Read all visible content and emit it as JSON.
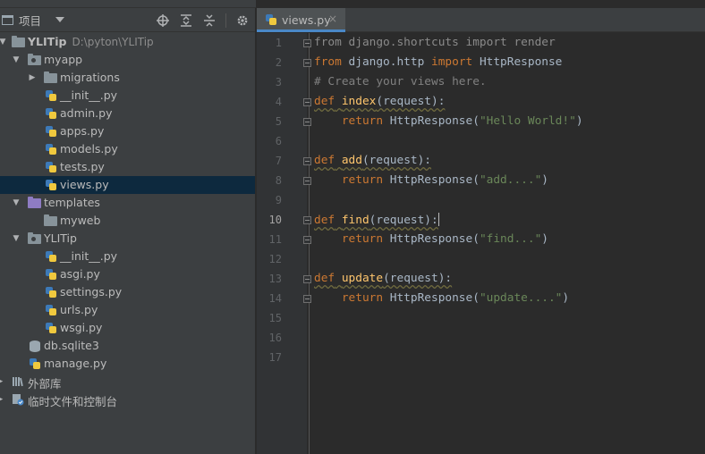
{
  "project_panel": {
    "title": "项目",
    "tree": [
      {
        "label": "YLITip",
        "path": "D:\\pyton\\YLITip",
        "level": 0,
        "kind": "folder",
        "expanded": true
      },
      {
        "label": "myapp",
        "level": 1,
        "kind": "folder-dot",
        "expanded": true
      },
      {
        "label": "migrations",
        "level": 2,
        "kind": "folder",
        "expanded": false
      },
      {
        "label": "__init__.py",
        "level": 2,
        "kind": "py"
      },
      {
        "label": "admin.py",
        "level": 2,
        "kind": "py"
      },
      {
        "label": "apps.py",
        "level": 2,
        "kind": "py"
      },
      {
        "label": "models.py",
        "level": 2,
        "kind": "py"
      },
      {
        "label": "tests.py",
        "level": 2,
        "kind": "py"
      },
      {
        "label": "views.py",
        "level": 2,
        "kind": "py",
        "selected": true
      },
      {
        "label": "templates",
        "level": 1,
        "kind": "folder-purple",
        "expanded": true
      },
      {
        "label": "myweb",
        "level": 2,
        "kind": "folder"
      },
      {
        "label": "YLITip",
        "level": 1,
        "kind": "folder-dot",
        "expanded": true
      },
      {
        "label": "__init__.py",
        "level": 2,
        "kind": "py"
      },
      {
        "label": "asgi.py",
        "level": 2,
        "kind": "py"
      },
      {
        "label": "settings.py",
        "level": 2,
        "kind": "py"
      },
      {
        "label": "urls.py",
        "level": 2,
        "kind": "py"
      },
      {
        "label": "wsgi.py",
        "level": 2,
        "kind": "py"
      },
      {
        "label": "db.sqlite3",
        "level": 1,
        "kind": "db"
      },
      {
        "label": "manage.py",
        "level": 1,
        "kind": "py"
      },
      {
        "label": "外部库",
        "level": 0,
        "kind": "lib",
        "expanded": false
      },
      {
        "label": "临时文件和控制台",
        "level": 0,
        "kind": "scratch",
        "expanded": false
      }
    ]
  },
  "editor": {
    "tab_label": "views.py",
    "tab_close": "×",
    "active_line": 10,
    "line_numbers": [
      "1",
      "2",
      "3",
      "4",
      "5",
      "6",
      "7",
      "8",
      "9",
      "10",
      "11",
      "12",
      "13",
      "14",
      "15",
      "16",
      "17"
    ],
    "code": {
      "l1_kw1": "from",
      "l1_mod": " django.shortcuts ",
      "l1_kw2": "import",
      "l1_name": " render",
      "l2_kw1": "from",
      "l2_mod": " django.http ",
      "l2_kw2": "import",
      "l2_name": " HttpResponse",
      "l3_comment": "# Create your views here.",
      "l4_def": "def",
      "l4_fn": "index",
      "l4_rest": "(request):",
      "l5_ret": "return",
      "l5_call": " HttpResponse(",
      "l5_str": "\"Hello World!\"",
      "l5_end": ")",
      "l7_def": "def",
      "l7_fn": "add",
      "l7_rest": "(request):",
      "l8_ret": "return",
      "l8_call": " HttpResponse(",
      "l8_str": "\"add....\"",
      "l8_end": ")",
      "l10_def": "def",
      "l10_fn": "find",
      "l10_rest": "(request):",
      "l11_ret": "return",
      "l11_call": " HttpResponse(",
      "l11_str": "\"find...\"",
      "l11_end": ")",
      "l13_def": "def",
      "l13_fn": "update",
      "l13_rest": "(request):",
      "l14_ret": "return",
      "l14_call": " HttpResponse(",
      "l14_str": "\"update....\"",
      "l14_end": ")"
    }
  },
  "icons": {
    "project_window": "project-window-icon",
    "locate": "crosshair-icon",
    "expand_all": "expand-all-icon",
    "collapse_all": "collapse-all-icon",
    "settings": "gear-icon"
  },
  "colors": {
    "panel_bg": "#3c3f41",
    "editor_bg": "#2b2b2b",
    "selected_row": "#0d293e",
    "keyword": "#cc7832",
    "function": "#ffc66d",
    "string": "#6a8759",
    "comment": "#808080",
    "tab_underline": "#4a88c7"
  }
}
